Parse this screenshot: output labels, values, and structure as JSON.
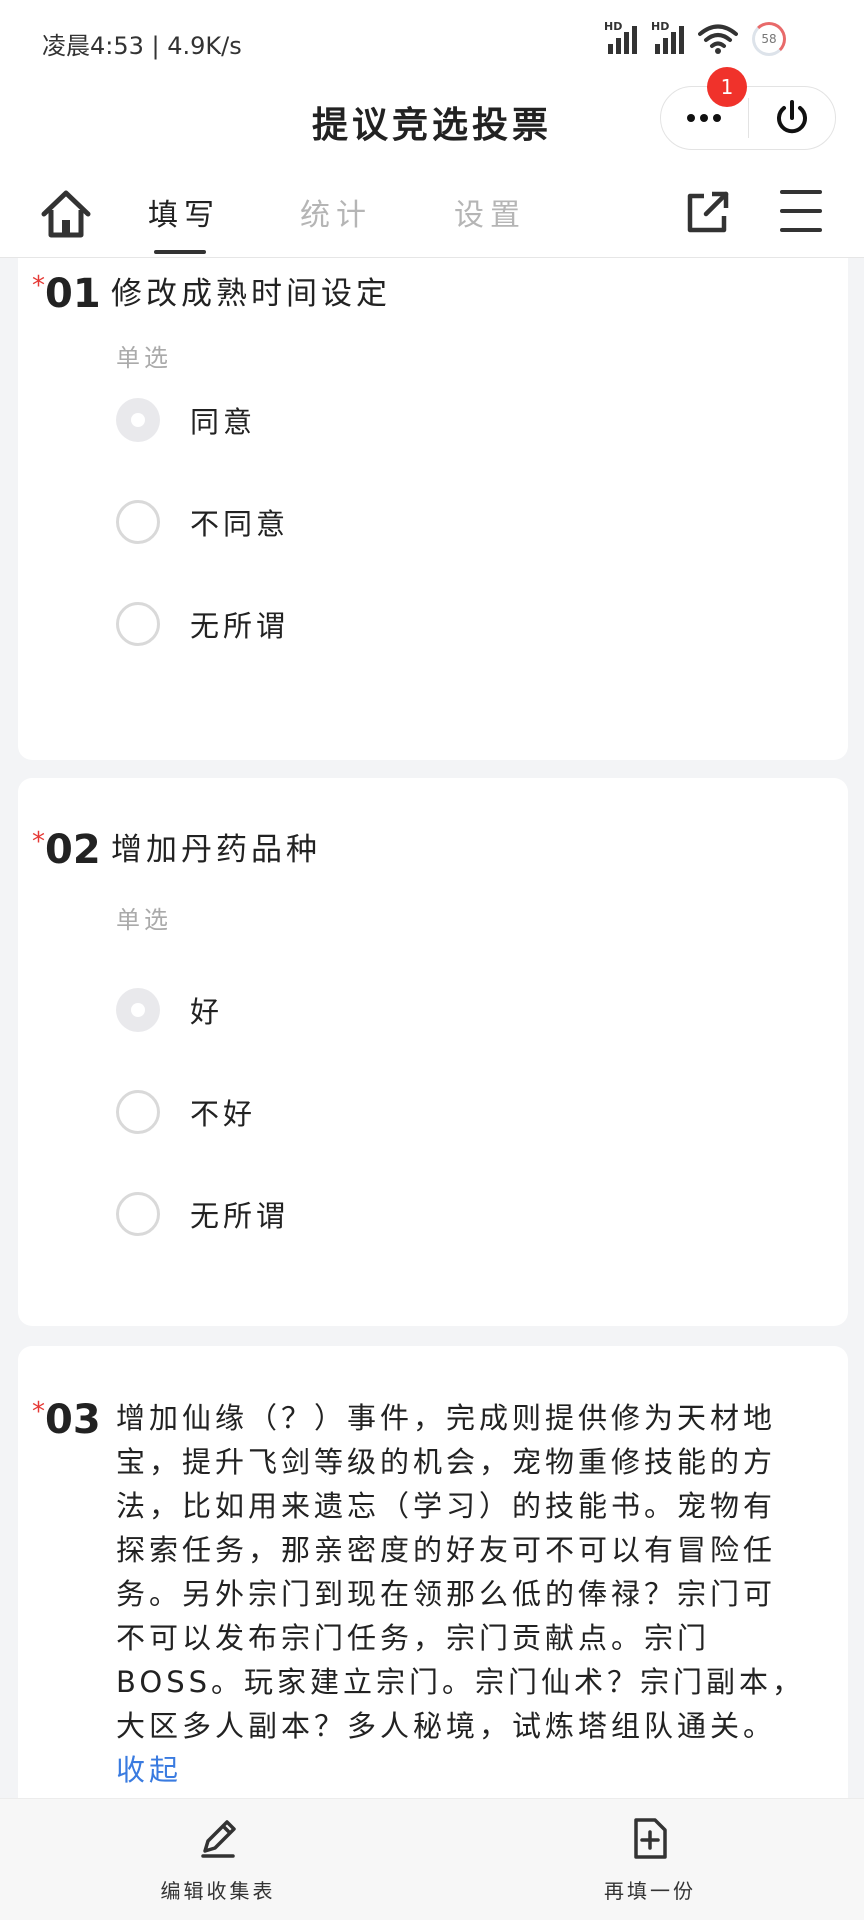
{
  "status_bar": {
    "time": "凌晨4:53 | 4.9K/s",
    "signal_1": "HD",
    "signal_2": "HD",
    "battery": "58"
  },
  "header": {
    "title": "提议竞选投票",
    "notification_count": "1"
  },
  "tabs": [
    {
      "label": "填写",
      "active": true
    },
    {
      "label": "统计",
      "active": false
    },
    {
      "label": "设置",
      "active": false
    }
  ],
  "questions": [
    {
      "number": "01",
      "required": "*",
      "title": "修改成熟时间设定",
      "type": "单选",
      "options": [
        {
          "label": "同意",
          "selected": true
        },
        {
          "label": "不同意",
          "selected": false
        },
        {
          "label": "无所谓",
          "selected": false
        }
      ]
    },
    {
      "number": "02",
      "required": "*",
      "title": "增加丹药品种",
      "type": "单选",
      "options": [
        {
          "label": "好",
          "selected": true
        },
        {
          "label": "不好",
          "selected": false
        },
        {
          "label": "无所谓",
          "selected": false
        }
      ]
    },
    {
      "number": "03",
      "required": "*",
      "title": "增加仙缘（？）事件，完成则提供修为天材地宝，提升飞剑等级的机会，宠物重修技能的方法，比如用来遗忘（学习）的技能书。宠物有探索任务，那亲密度的好友可不可以有冒险任务。另外宗门到现在领那么低的俸禄？宗门可不可以发布宗门任务，宗门贡献点。宗门BOSS。玩家建立宗门。宗门仙术？宗门副本，大区多人副本？多人秘境，试炼塔组队通关。",
      "collapse_label": "收起"
    }
  ],
  "bottom_bar": {
    "edit_label": "编辑收集表",
    "refill_label": "再填一份"
  },
  "colors": {
    "required": "#e53935",
    "link": "#3a7be0",
    "badge": "#f0322b"
  }
}
